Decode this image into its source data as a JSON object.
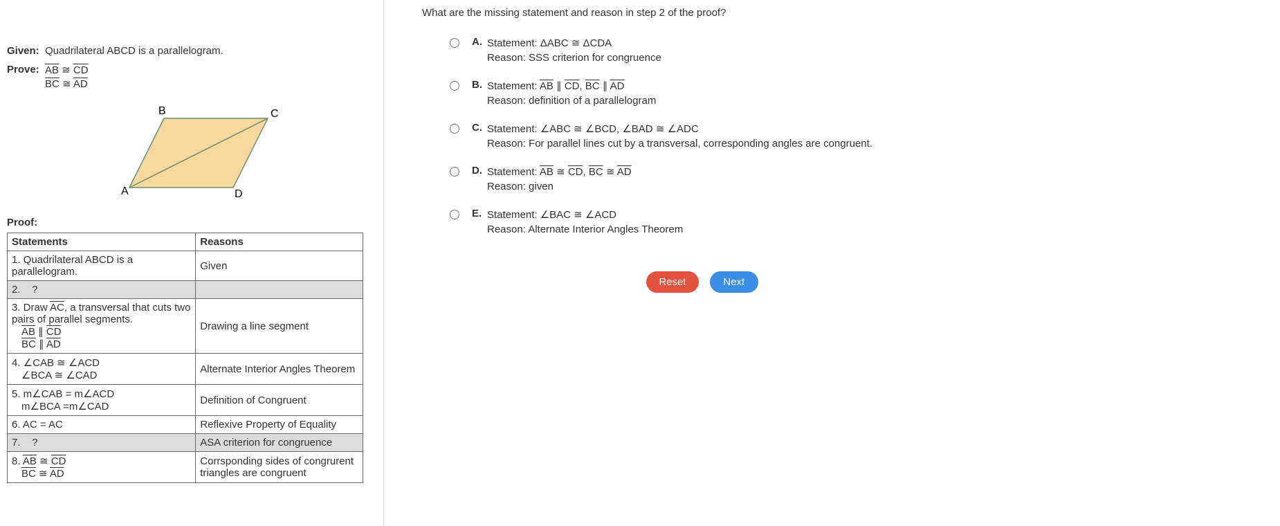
{
  "left": {
    "given_label": "Given:",
    "given_text": "Quadrilateral ABCD is a parallelogram.",
    "prove_label": "Prove:",
    "prove_line1_a": "AB",
    "prove_line1_b": "CD",
    "prove_line2_a": "BC",
    "prove_line2_b": "AD",
    "fig": {
      "A": "A",
      "B": "B",
      "C": "C",
      "D": "D"
    },
    "proof_label": "Proof:",
    "headers": {
      "statements": "Statements",
      "reasons": "Reasons"
    },
    "rows": {
      "r1s": "1. Quadrilateral ABCD is a parallelogram.",
      "r1r": "Given",
      "r2s": "2.    ?",
      "r2r": "",
      "r3s_pre": "3. Draw ",
      "r3s_ac": "AC",
      "r3s_post": ", a transversal that cuts two pairs of parallel segments.",
      "r3s_l1a": "AB",
      "r3s_l1b": "CD",
      "r3s_l2a": "BC",
      "r3s_l2b": "AD",
      "r3r": "Drawing a line segment",
      "r4s_l1": "4. ∠CAB ≅ ∠ACD",
      "r4s_l2": "∠BCA ≅ ∠CAD",
      "r4r": "Alternate Interior Angles Theorem",
      "r5s_l1": "5. m∠CAB = m∠ACD",
      "r5s_l2": "m∠BCA =m∠CAD",
      "r5r": "Definition of Congruent",
      "r6s": "6. AC = AC",
      "r6r": "Reflexive Property of Equality",
      "r7s": "7.    ?",
      "r7r": "ASA criterion for congruence",
      "r8s_a1": "AB",
      "r8s_a2": "CD",
      "r8s_b1": "BC",
      "r8s_b2": "AD",
      "r8s_pre": "8. ",
      "r8r": "Corrsponding sides of congrurent triangles are congruent"
    }
  },
  "right": {
    "question": "What are the missing statement and reason in step 2 of the proof?",
    "choices": {
      "A": {
        "stmt": "Statement: ΔABC ≅ ΔCDA",
        "reason": "Reason: SSS criterion for congruence"
      },
      "B": {
        "stmt_pre": "Statement: ",
        "s1a": "AB",
        "s1b": "CD",
        "s2a": "BC",
        "s2b": "AD",
        "reason": "Reason: definition of a parallelogram"
      },
      "C": {
        "stmt": "Statement: ∠ABC ≅ ∠BCD, ∠BAD ≅ ∠ADC",
        "reason": "Reason: For parallel lines cut by a transversal, corresponding angles are congruent."
      },
      "D": {
        "stmt_pre": "Statement: ",
        "s1a": "AB",
        "s1b": "CD",
        "s2a": "BC",
        "s2b": "AD",
        "reason": "Reason: given"
      },
      "E": {
        "stmt": "Statement: ∠BAC ≅ ∠ACD",
        "reason": "Reason: Alternate Interior Angles Theorem"
      }
    },
    "letters": {
      "A": "A.",
      "B": "B.",
      "C": "C.",
      "D": "D.",
      "E": "E."
    },
    "buttons": {
      "reset": "Reset",
      "next": "Next"
    }
  }
}
